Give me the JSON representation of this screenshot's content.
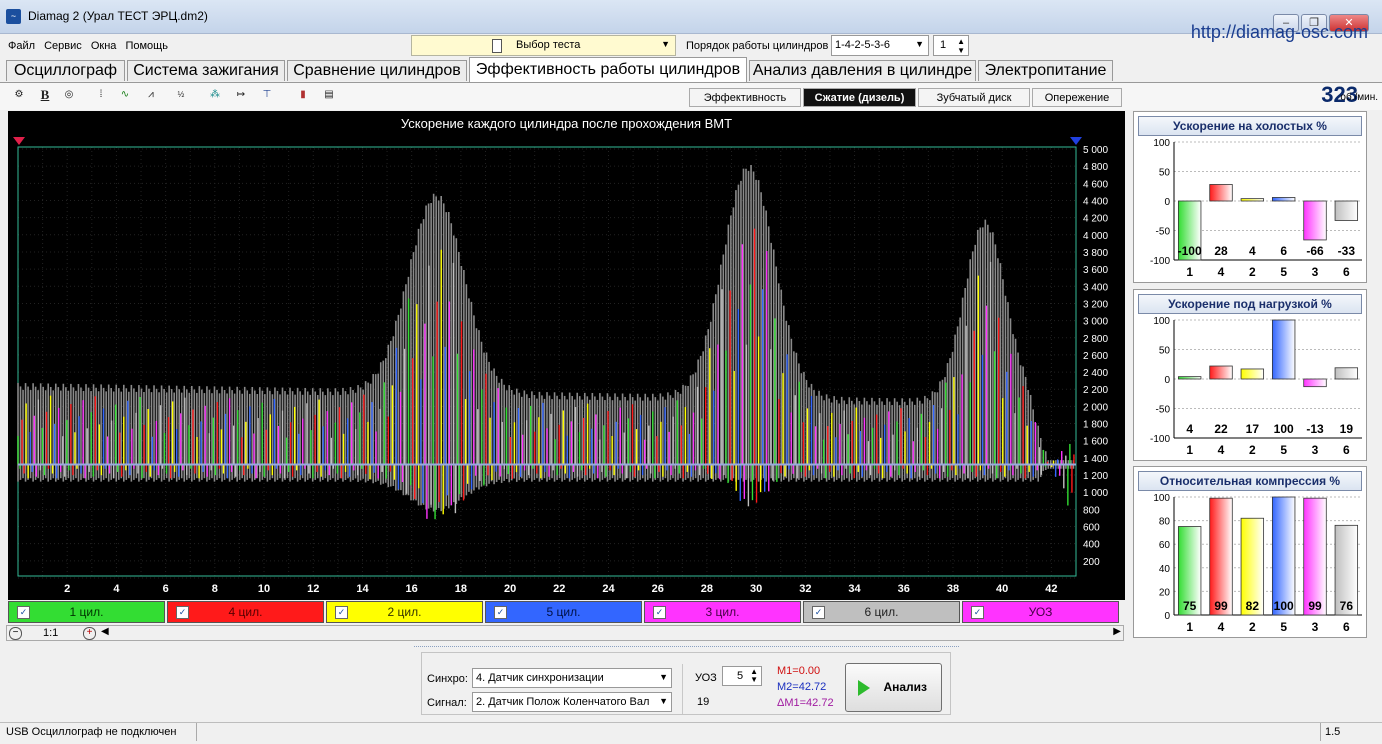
{
  "window": {
    "title": "Diamag 2 (Урал ТЕСТ ЭРЦ.dm2)",
    "site_link": "http://diamag-osc.com"
  },
  "menu": [
    "Файл",
    "Сервис",
    "Окна",
    "Помощь"
  ],
  "test_select": {
    "label": "Выбор теста"
  },
  "cylinder_order": {
    "label": "Порядок работы цилиндров",
    "value": "1-4-2-5-3-6",
    "spin_value": "1"
  },
  "tabs": [
    {
      "label": "Осциллограф",
      "active": false
    },
    {
      "label": "Система зажигания",
      "active": false
    },
    {
      "label": "Сравнение цилиндров",
      "active": false
    },
    {
      "label": "Эффективность работы цилиндров",
      "active": true
    },
    {
      "label": "Анализ давления в цилиндре",
      "active": false
    },
    {
      "label": "Электропитание",
      "active": false
    }
  ],
  "subtabs": [
    {
      "label": "Эффективность",
      "active": false
    },
    {
      "label": "Сжатие (дизель)",
      "active": true
    },
    {
      "label": "Зубчатый диск",
      "active": false
    },
    {
      "label": "Опережение",
      "active": false
    }
  ],
  "toolbar_icons": [
    "settings-icon",
    "bold-icon",
    "rpm-icon",
    "scale-icon",
    "wave-icon",
    "vvti-icon",
    "algorithm-icon",
    "network-icon",
    "counter-icon",
    "marker-icon",
    "cylinder-chart-icon",
    "stats-icon"
  ],
  "rpm": {
    "value": "323",
    "unit": "об./мин."
  },
  "main_chart": {
    "title": "Ускорение каждого цилиндра после прохождения ВМТ",
    "y_ticks": [
      "5 000",
      "4 800",
      "4 600",
      "4 400",
      "4 200",
      "4 000",
      "3 800",
      "3 600",
      "3 400",
      "3 200",
      "3 000",
      "2 800",
      "2 600",
      "2 400",
      "2 200",
      "2 000",
      "1 800",
      "1 600",
      "1 400",
      "1 200",
      "1 000",
      "800",
      "600",
      "400",
      "200"
    ],
    "x_ticks": [
      "2",
      "4",
      "6",
      "8",
      "10",
      "12",
      "14",
      "16",
      "18",
      "20",
      "22",
      "24",
      "26",
      "28",
      "30",
      "32",
      "34",
      "36",
      "38",
      "40",
      "42"
    ]
  },
  "legend": [
    {
      "label": "1 цил.",
      "color": "#33dd33",
      "text_color": "#003300"
    },
    {
      "label": "4 цил.",
      "color": "#ff1a1a",
      "text_color": "#550000"
    },
    {
      "label": "2 цил.",
      "color": "#ffff00",
      "text_color": "#333300"
    },
    {
      "label": "5 цил.",
      "color": "#3366ff",
      "text_color": "#001144"
    },
    {
      "label": "3 цил.",
      "color": "#ff33ff",
      "text_color": "#440044"
    },
    {
      "label": "6 цил.",
      "color": "#bfbfbf",
      "text_color": "#222222"
    },
    {
      "label": "УОЗ",
      "color": "#ff33ff",
      "text_color": "#440044"
    }
  ],
  "zoom": {
    "value": "1:1"
  },
  "controls": {
    "sync_label": "Синхро:",
    "sync_value": "4. Датчик синхронизации",
    "signal_label": "Сигнал:",
    "signal_value": "2. Датчик Полож Коленчатого Вал",
    "uoz_label": "УОЗ",
    "uoz_value": "5",
    "uoz_sub": "19",
    "m1": "M1=0.00",
    "m2": "M2=42.72",
    "dm": "ΔM1=42.72",
    "analyze_label": "Анализ"
  },
  "status": {
    "text": "USB Осциллограф не подключен",
    "value": "1.5"
  },
  "chart_data": [
    {
      "type": "bar",
      "title": "Ускорение на холостых %",
      "categories": [
        "1",
        "4",
        "2",
        "5",
        "3",
        "6"
      ],
      "values": [
        -100,
        28,
        4,
        6,
        -66,
        -33
      ],
      "colors": [
        "#33dd33",
        "#ff1a1a",
        "#ffff00",
        "#3366ff",
        "#ff33ff",
        "#bfbfbf"
      ],
      "ylim": [
        -100,
        100
      ],
      "y_ticks": [
        "100",
        "50",
        "0",
        "-50",
        "-100"
      ]
    },
    {
      "type": "bar",
      "title": "Ускорение под нагрузкой %",
      "categories": [
        "1",
        "4",
        "2",
        "5",
        "3",
        "6"
      ],
      "values": [
        4,
        22,
        17,
        100,
        -13,
        19
      ],
      "colors": [
        "#33dd33",
        "#ff1a1a",
        "#ffff00",
        "#3366ff",
        "#ff33ff",
        "#bfbfbf"
      ],
      "ylim": [
        -100,
        100
      ],
      "y_ticks": [
        "100",
        "50",
        "0",
        "-50",
        "-100"
      ]
    },
    {
      "type": "bar",
      "title": "Относительная компрессия %",
      "categories": [
        "1",
        "4",
        "2",
        "5",
        "3",
        "6"
      ],
      "values": [
        75,
        99,
        82,
        100,
        99,
        76
      ],
      "colors": [
        "#33dd33",
        "#ff1a1a",
        "#ffff00",
        "#3366ff",
        "#ff33ff",
        "#bfbfbf"
      ],
      "ylim": [
        0,
        100
      ],
      "y_ticks": [
        "100",
        "80",
        "60",
        "40",
        "20",
        "0"
      ]
    }
  ]
}
